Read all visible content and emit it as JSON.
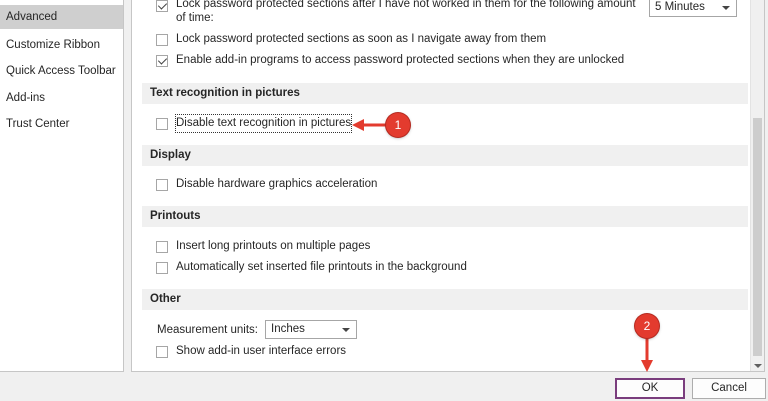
{
  "sidebar": {
    "items": [
      {
        "label": "Advanced",
        "selected": true
      },
      {
        "label": "Customize Ribbon",
        "selected": false
      },
      {
        "label": "Quick Access Toolbar",
        "selected": false
      },
      {
        "label": "Add-ins",
        "selected": false
      },
      {
        "label": "Trust Center",
        "selected": false
      }
    ]
  },
  "password": {
    "lock_after_line1": "Lock password protected sections after I have not worked in them for the following amount",
    "lock_after_line2": "of time:",
    "lock_after_checked": true,
    "lock_after_value": "5 Minutes",
    "lock_on_navigate": "Lock password protected sections as soon as I navigate away from them",
    "lock_on_navigate_checked": false,
    "enable_addins": "Enable add-in programs to access password protected sections when they are unlocked",
    "enable_addins_checked": true
  },
  "text_recognition": {
    "header": "Text recognition in pictures",
    "disable_label": "Disable text recognition in pictures",
    "disable_checked": false
  },
  "display": {
    "header": "Display",
    "disable_hw_label": "Disable hardware graphics acceleration",
    "disable_hw_checked": false
  },
  "printouts": {
    "header": "Printouts",
    "long_printouts_label": "Insert long printouts on multiple pages",
    "long_printouts_checked": false,
    "auto_background_label": "Automatically set inserted file printouts in the background",
    "auto_background_checked": false
  },
  "other": {
    "header": "Other",
    "measurement_label": "Measurement units:",
    "measurement_value": "Inches",
    "show_addin_errors_label": "Show add-in user interface errors",
    "show_addin_errors_checked": false
  },
  "buttons": {
    "ok": "OK",
    "cancel": "Cancel"
  },
  "annotations": {
    "marker1": "1",
    "marker2": "2",
    "color": "#e33b2e"
  }
}
